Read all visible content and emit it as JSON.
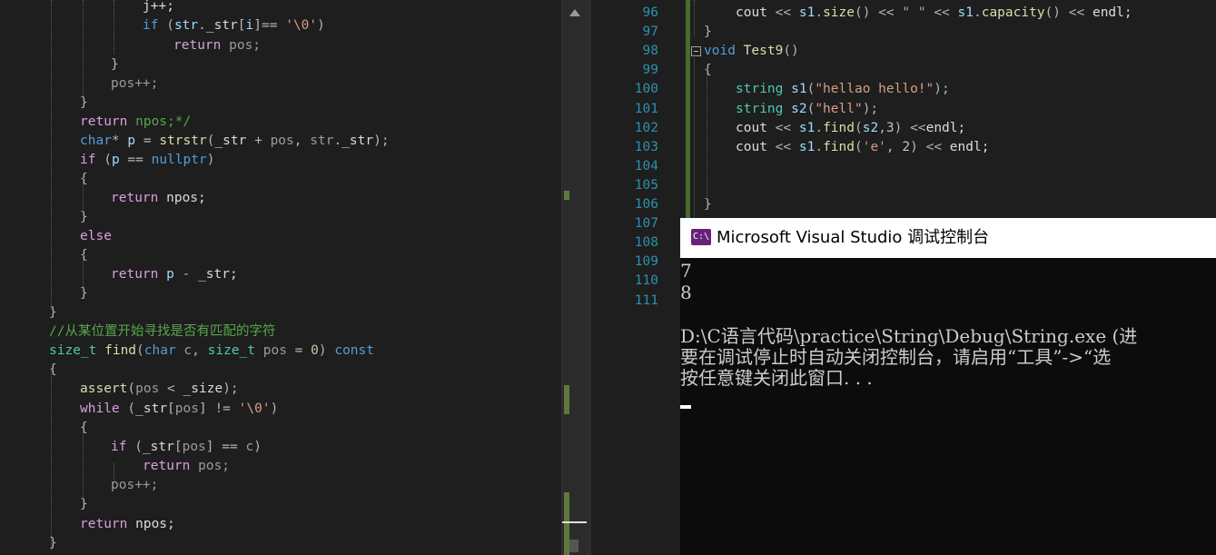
{
  "left_editor": {
    "lines": [
      [
        {
          "t": "j++;",
          "c": "plain"
        }
      ],
      [
        {
          "t": "if ",
          "c": "kw"
        },
        {
          "t": "(",
          "c": "op"
        },
        {
          "t": "str",
          "c": "var"
        },
        {
          "t": ".",
          "c": "op"
        },
        {
          "t": "_str",
          "c": "mem"
        },
        {
          "t": "[",
          "c": "op"
        },
        {
          "t": "i",
          "c": "var"
        },
        {
          "t": "]== ",
          "c": "op"
        },
        {
          "t": "'\\0'",
          "c": "str"
        },
        {
          "t": ")",
          "c": "op"
        }
      ],
      [
        {
          "t": "return ",
          "c": "ctl"
        },
        {
          "t": "pos;",
          "c": "grey"
        }
      ],
      [
        {
          "t": "}",
          "c": "op"
        }
      ],
      [
        {
          "t": "pos++;",
          "c": "grey"
        }
      ],
      [
        {
          "t": "}",
          "c": "op"
        }
      ],
      [
        {
          "t": "return ",
          "c": "ctl"
        },
        {
          "t": "npos;*/",
          "c": "cm"
        }
      ],
      [
        {
          "t": "char",
          "c": "kw"
        },
        {
          "t": "* ",
          "c": "op"
        },
        {
          "t": "p",
          "c": "var"
        },
        {
          "t": " = ",
          "c": "op"
        },
        {
          "t": "strstr",
          "c": "fn"
        },
        {
          "t": "(",
          "c": "op"
        },
        {
          "t": "_str",
          "c": "mem"
        },
        {
          "t": " + ",
          "c": "op"
        },
        {
          "t": "pos",
          "c": "grey"
        },
        {
          "t": ", ",
          "c": "op"
        },
        {
          "t": "str",
          "c": "grey"
        },
        {
          "t": ".",
          "c": "op"
        },
        {
          "t": "_str",
          "c": "mem"
        },
        {
          "t": ");",
          "c": "op"
        }
      ],
      [
        {
          "t": "if ",
          "c": "ctl"
        },
        {
          "t": "(",
          "c": "op"
        },
        {
          "t": "p",
          "c": "var"
        },
        {
          "t": " == ",
          "c": "op"
        },
        {
          "t": "nullptr",
          "c": "kw"
        },
        {
          "t": ")",
          "c": "op"
        }
      ],
      [
        {
          "t": "{",
          "c": "op"
        }
      ],
      [
        {
          "t": "return ",
          "c": "ctl"
        },
        {
          "t": "npos;",
          "c": "plain"
        }
      ],
      [
        {
          "t": "}",
          "c": "op"
        }
      ],
      [
        {
          "t": "else",
          "c": "ctl"
        }
      ],
      [
        {
          "t": "{",
          "c": "op"
        }
      ],
      [
        {
          "t": "return ",
          "c": "ctl"
        },
        {
          "t": "p",
          "c": "var"
        },
        {
          "t": " - ",
          "c": "op"
        },
        {
          "t": "_str;",
          "c": "mem"
        }
      ],
      [
        {
          "t": "}",
          "c": "op"
        }
      ],
      [
        {
          "t": "}",
          "c": "op"
        }
      ],
      [
        {
          "t": "//从某位置开始寻找是否有匹配的字符",
          "c": "cm"
        }
      ],
      [
        {
          "t": "size_t ",
          "c": "ty"
        },
        {
          "t": "find",
          "c": "fn"
        },
        {
          "t": "(",
          "c": "op"
        },
        {
          "t": "char ",
          "c": "kw"
        },
        {
          "t": "c",
          "c": "grey"
        },
        {
          "t": ", ",
          "c": "op"
        },
        {
          "t": "size_t ",
          "c": "ty"
        },
        {
          "t": "pos",
          "c": "grey"
        },
        {
          "t": " = ",
          "c": "op"
        },
        {
          "t": "0",
          "c": "num"
        },
        {
          "t": ") ",
          "c": "op"
        },
        {
          "t": "const",
          "c": "kw"
        }
      ],
      [
        {
          "t": "{",
          "c": "op"
        }
      ],
      [
        {
          "t": "assert",
          "c": "fn"
        },
        {
          "t": "(",
          "c": "op"
        },
        {
          "t": "pos",
          "c": "grey"
        },
        {
          "t": " < ",
          "c": "op"
        },
        {
          "t": "_size",
          "c": "mem"
        },
        {
          "t": ");",
          "c": "op"
        }
      ],
      [
        {
          "t": "while ",
          "c": "ctl"
        },
        {
          "t": "(",
          "c": "op"
        },
        {
          "t": "_str",
          "c": "mem"
        },
        {
          "t": "[",
          "c": "op"
        },
        {
          "t": "pos",
          "c": "grey"
        },
        {
          "t": "] != ",
          "c": "op"
        },
        {
          "t": "'\\0'",
          "c": "str"
        },
        {
          "t": ")",
          "c": "op"
        }
      ],
      [
        {
          "t": "{",
          "c": "op"
        }
      ],
      [
        {
          "t": "if ",
          "c": "ctl"
        },
        {
          "t": "(",
          "c": "op"
        },
        {
          "t": "_str",
          "c": "mem"
        },
        {
          "t": "[",
          "c": "op"
        },
        {
          "t": "pos",
          "c": "grey"
        },
        {
          "t": "] == ",
          "c": "op"
        },
        {
          "t": "c",
          "c": "grey"
        },
        {
          "t": ")",
          "c": "op"
        }
      ],
      [
        {
          "t": "return ",
          "c": "ctl"
        },
        {
          "t": "pos;",
          "c": "grey"
        }
      ],
      [
        {
          "t": "pos++;",
          "c": "grey"
        }
      ],
      [
        {
          "t": "}",
          "c": "op"
        }
      ],
      [
        {
          "t": "return ",
          "c": "ctl"
        },
        {
          "t": "npos;",
          "c": "plain"
        }
      ],
      [
        {
          "t": "}",
          "c": "op"
        }
      ]
    ]
  },
  "right_editor": {
    "line_numbers": [
      "96",
      "97",
      "98",
      "99",
      "100",
      "101",
      "102",
      "103",
      "104",
      "105",
      "106",
      "107",
      "108",
      "109",
      "110",
      "111"
    ],
    "lines": [
      [
        {
          "t": "cout ",
          "c": "plain"
        },
        {
          "t": "<< ",
          "c": "op"
        },
        {
          "t": "s1",
          "c": "var"
        },
        {
          "t": ".",
          "c": "op"
        },
        {
          "t": "size",
          "c": "fn"
        },
        {
          "t": "() ",
          "c": "op"
        },
        {
          "t": "<< ",
          "c": "op"
        },
        {
          "t": "\" \"",
          "c": "str"
        },
        {
          "t": " << ",
          "c": "op"
        },
        {
          "t": "s1",
          "c": "var"
        },
        {
          "t": ".",
          "c": "op"
        },
        {
          "t": "capacity",
          "c": "fn"
        },
        {
          "t": "() ",
          "c": "op"
        },
        {
          "t": "<< ",
          "c": "op"
        },
        {
          "t": "endl;",
          "c": "plain"
        }
      ],
      [
        {
          "t": "}",
          "c": "op"
        }
      ],
      [
        {
          "t": "void ",
          "c": "kw"
        },
        {
          "t": "Test9",
          "c": "fn"
        },
        {
          "t": "()",
          "c": "op"
        }
      ],
      [
        {
          "t": "{",
          "c": "op"
        }
      ],
      [
        {
          "t": "string ",
          "c": "ty"
        },
        {
          "t": "s1",
          "c": "var"
        },
        {
          "t": "(",
          "c": "op"
        },
        {
          "t": "\"hellao hello!\"",
          "c": "str"
        },
        {
          "t": ");",
          "c": "op"
        }
      ],
      [
        {
          "t": "string ",
          "c": "ty"
        },
        {
          "t": "s2",
          "c": "var"
        },
        {
          "t": "(",
          "c": "op"
        },
        {
          "t": "\"hell\"",
          "c": "str"
        },
        {
          "t": ");",
          "c": "op"
        }
      ],
      [
        {
          "t": "cout ",
          "c": "plain"
        },
        {
          "t": "<< ",
          "c": "op"
        },
        {
          "t": "s1",
          "c": "var"
        },
        {
          "t": ".",
          "c": "op"
        },
        {
          "t": "find",
          "c": "fn"
        },
        {
          "t": "(",
          "c": "op"
        },
        {
          "t": "s2",
          "c": "var"
        },
        {
          "t": ",",
          "c": "op"
        },
        {
          "t": "3",
          "c": "num"
        },
        {
          "t": ") ",
          "c": "op"
        },
        {
          "t": "<<",
          "c": "op"
        },
        {
          "t": "endl;",
          "c": "plain"
        }
      ],
      [
        {
          "t": "cout ",
          "c": "plain"
        },
        {
          "t": "<< ",
          "c": "op"
        },
        {
          "t": "s1",
          "c": "var"
        },
        {
          "t": ".",
          "c": "op"
        },
        {
          "t": "find",
          "c": "fn"
        },
        {
          "t": "(",
          "c": "op"
        },
        {
          "t": "'e'",
          "c": "str"
        },
        {
          "t": ", ",
          "c": "op"
        },
        {
          "t": "2",
          "c": "num"
        },
        {
          "t": ") ",
          "c": "op"
        },
        {
          "t": "<< ",
          "c": "op"
        },
        {
          "t": "endl;",
          "c": "plain"
        }
      ],
      [],
      [],
      [
        {
          "t": "}",
          "c": "op"
        }
      ]
    ]
  },
  "console": {
    "title": "Microsoft Visual Studio 调试控制台",
    "icon_label": "C:\\",
    "output_lines": [
      "7",
      "8",
      "",
      "D:\\C语言代码\\practice\\String\\Debug\\String.exe (进",
      "要在调试停止时自动关闭控制台，请启用“工具”->“选",
      "按任意键关闭此窗口. . ."
    ]
  },
  "icons": {
    "scroll_up": "scroll-up-arrow-icon",
    "collapse": "collapse-minus-icon",
    "console_app": "console-app-icon"
  }
}
